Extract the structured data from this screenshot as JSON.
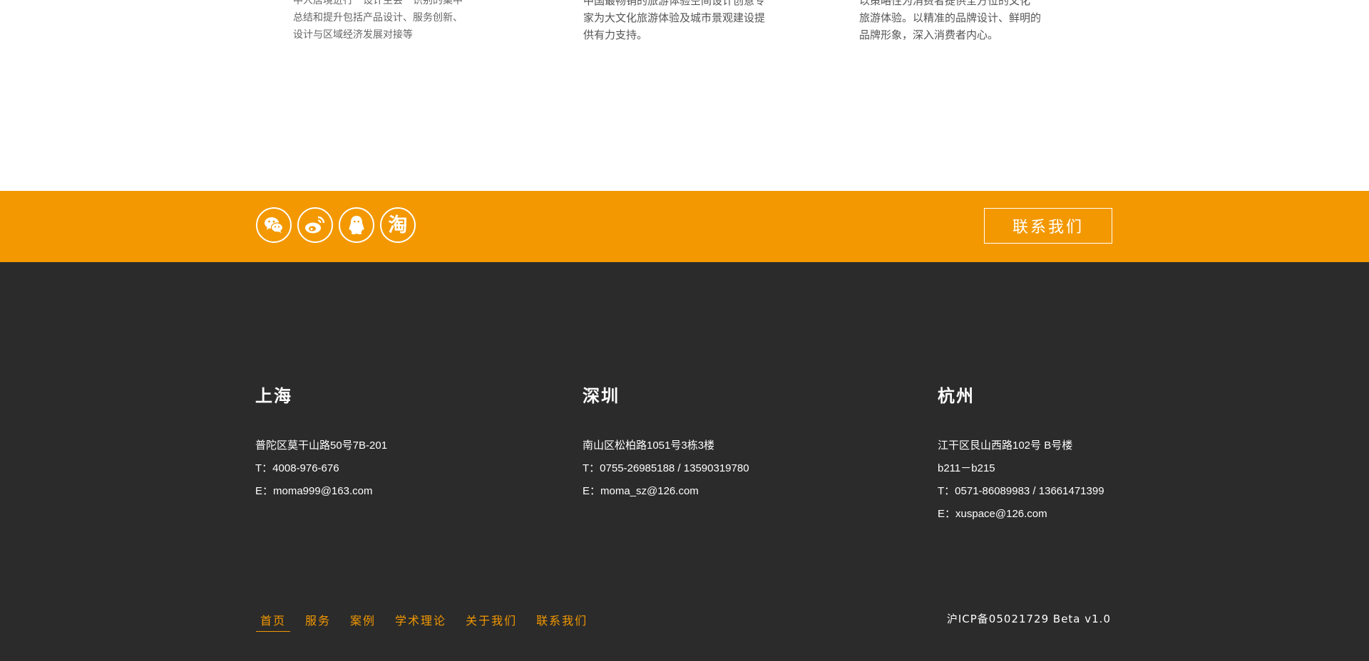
{
  "services": [
    {
      "lines": [
        "中人居境进行一设计主会一识别的集中",
        "总结和提升包括产品设计、服务创新、",
        "设计与区域经济发展对接等"
      ]
    },
    {
      "lines": [
        "中国最畅销的旅游体验空间设计创意专",
        "家为大文化旅游体验及城市景观建设提",
        "供有力支持。"
      ]
    },
    {
      "lines": [
        "以策略性为消费者提供全方位的文化",
        "旅游体验。以精准的品牌设计、鲜明的",
        "品牌形象，深入消费者内心。"
      ]
    }
  ],
  "social": {
    "icons": [
      "wechat-icon",
      "weibo-icon",
      "qq-icon",
      "taobao-icon"
    ],
    "taobao_char": "淘"
  },
  "contact_button": "联系我们",
  "offices": [
    {
      "city": "上海",
      "lines": [
        "普陀区莫干山路50号7B-201",
        "T：4008-976-676",
        "E：moma999@163.com"
      ]
    },
    {
      "city": "深圳",
      "lines": [
        "南山区松柏路1051号3栋3楼",
        "T：0755-26985188 / 13590319780",
        "E：moma_sz@126.com"
      ]
    },
    {
      "city": "杭州",
      "lines": [
        "江干区艮山西路102号 B号楼",
        "b211－b215",
        "T：0571-86089983 / 13661471399",
        "E：xuspace@126.com"
      ]
    }
  ],
  "nav": [
    "首页",
    "服务",
    "案例",
    "学术理论",
    "关于我们",
    "联系我们"
  ],
  "icp": "沪ICP备05021729 Beta v1.0",
  "colors": {
    "accent": "#f39800",
    "footer_bg": "#2b2b2b"
  }
}
